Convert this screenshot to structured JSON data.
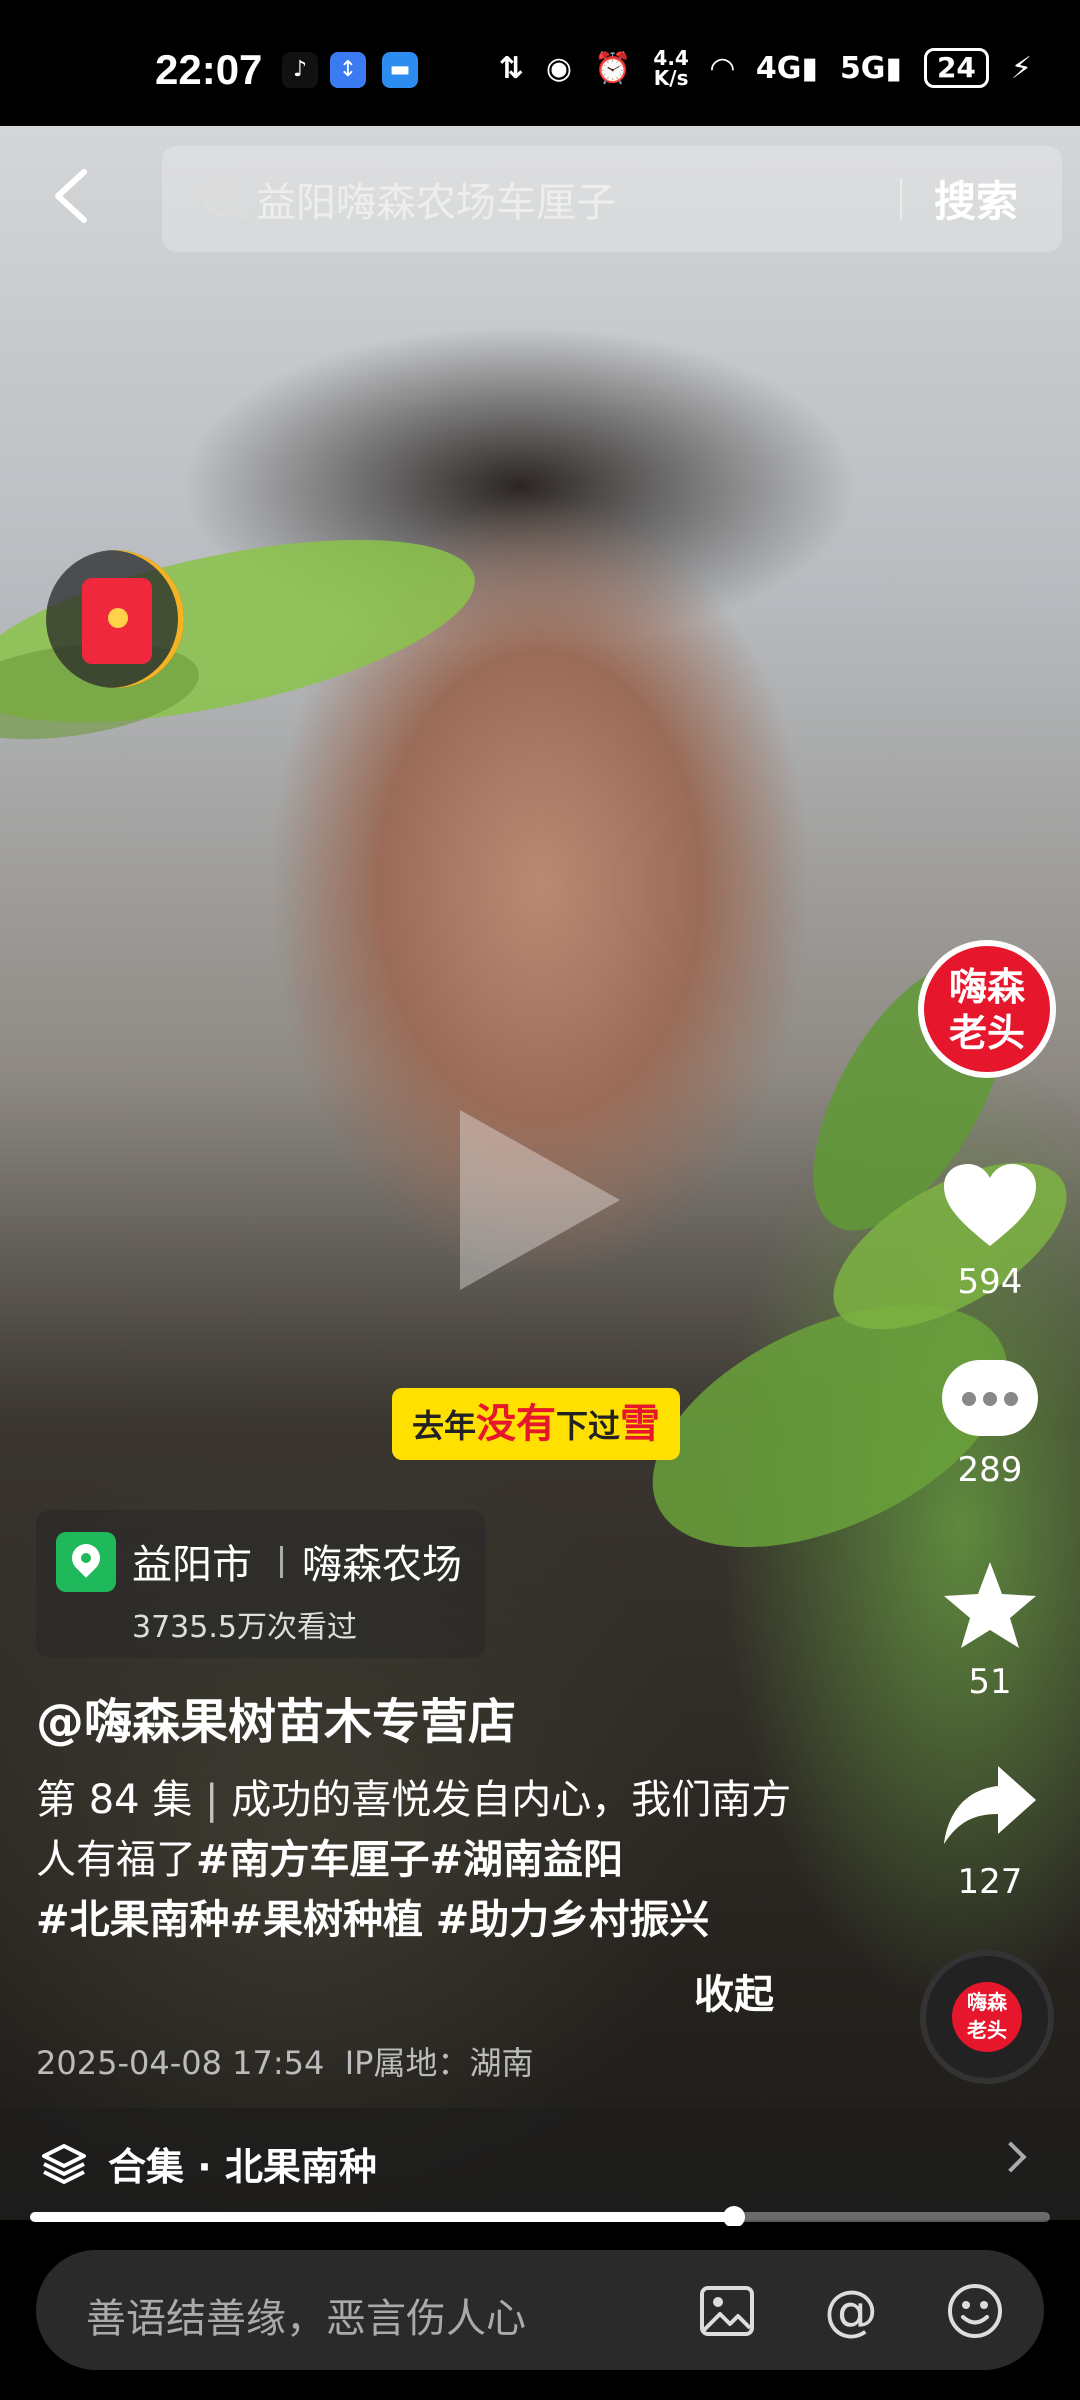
{
  "status_bar": {
    "time": "22:07",
    "net_speed": "4.4\nK/s",
    "battery": "24",
    "icons": [
      "tiktok-icon",
      "app-icon",
      "message-icon",
      "data-icon",
      "eye-icon",
      "alarm-icon",
      "wifi-icon",
      "signal-4g-icon",
      "signal-5g-icon",
      "charging-icon"
    ]
  },
  "search": {
    "query": "益阳嗨森农场车厘子",
    "button": "搜索"
  },
  "video": {
    "caption_parts": [
      "去年",
      "没有",
      "下过",
      "雪"
    ],
    "progress": 0.69
  },
  "side": {
    "avatar_text": "嗨森\n老头",
    "likes": "594",
    "comments": "289",
    "favorites": "51",
    "shares": "127",
    "disc_text": "嗨森\n老头"
  },
  "location": {
    "city": "益阳市",
    "place": "嗨森农场",
    "views": "3735.5万次看过"
  },
  "post": {
    "author": "@嗨森果树苗木专营店",
    "episode": "第 84 集",
    "text": "成功的喜悦发自内心，我们南方人有福了",
    "tags": [
      "#南方车厘子",
      "#湖南益阳",
      "#北果南种",
      "#果树种植",
      "#助力乡村振兴"
    ],
    "collapse": "收起",
    "date": "2025-04-08 17:54",
    "ip": "IP属地：湖南"
  },
  "collection": {
    "label": "合集 · 北果南种"
  },
  "comment_bar": {
    "placeholder": "善语结善缘，恶言伤人心"
  },
  "colors": {
    "accent_red": "#e6162d",
    "sticker_yellow": "#ffe000",
    "location_green": "#1fb85a"
  }
}
